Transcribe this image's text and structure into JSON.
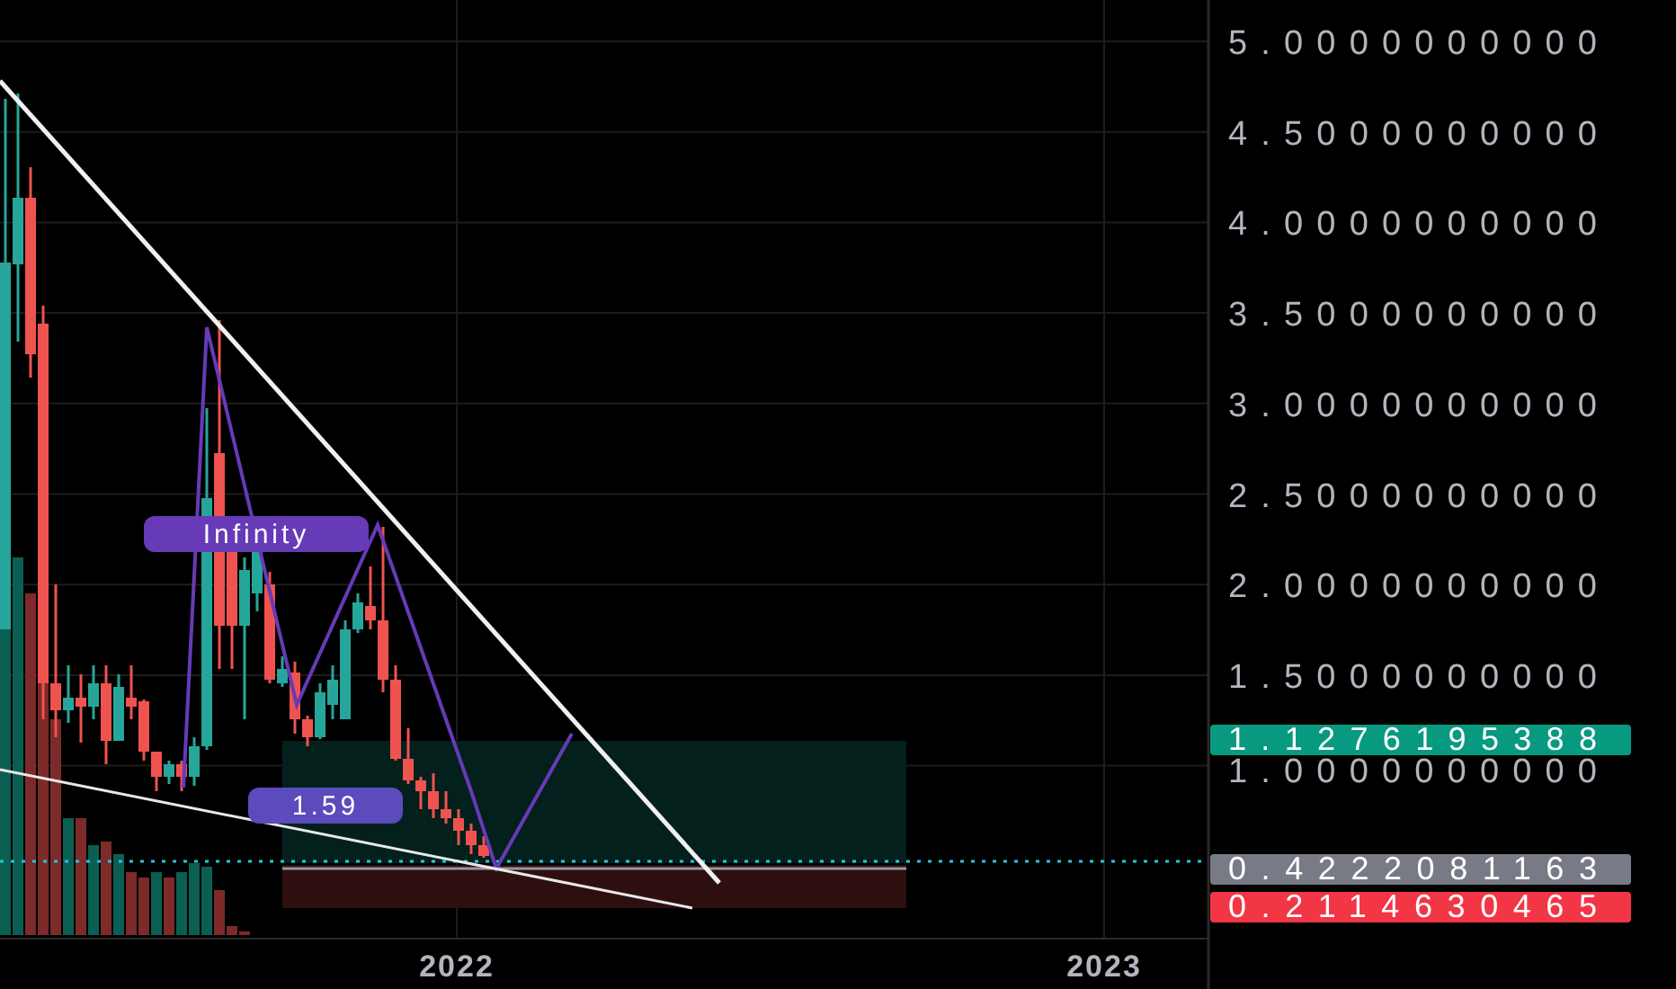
{
  "price_axis": {
    "ticks": [
      "5.0000000000",
      "4.5000000000",
      "4.0000000000",
      "3.5000000000",
      "3.0000000000",
      "2.5000000000",
      "2.0000000000",
      "1.5000000000",
      "1.0000000000"
    ]
  },
  "price_badges": [
    {
      "text": "1.1276195388",
      "color": "#089981"
    },
    {
      "text": "0.4222081163",
      "color": "#787b86"
    },
    {
      "text": "0.2114630465",
      "color": "#f23645"
    }
  ],
  "time_axis": {
    "labels": [
      "2022",
      "2023"
    ]
  },
  "annotations": [
    {
      "text": "Infinity"
    },
    {
      "text": "1.59"
    }
  ]
}
